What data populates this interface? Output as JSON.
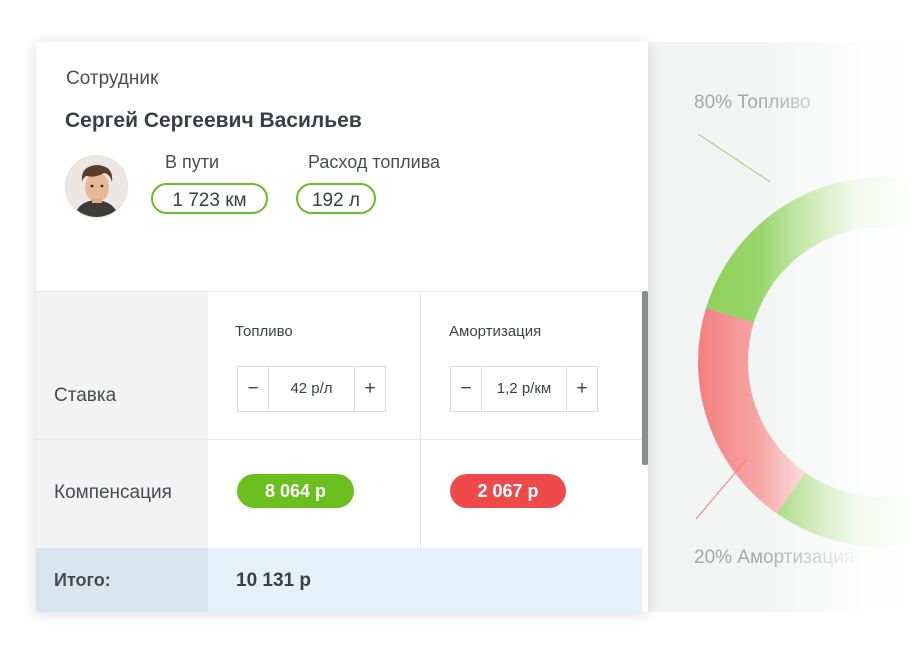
{
  "employee": {
    "section_label": "Сотрудник",
    "name": "Сергей Сергеевич Васильев",
    "distance_label": "В пути",
    "distance_value": "1 723 км",
    "fuel_label": "Расход топлива",
    "fuel_value": "192 л"
  },
  "table": {
    "rate_label": "Ставка",
    "compensation_label": "Компенсация",
    "total_label": "Итого:",
    "total_value": "10 131 р",
    "columns": [
      {
        "header": "Топливо",
        "rate_value": "42 р/л",
        "compensation": "8 064 р",
        "badge_color": "#6bbf1f"
      },
      {
        "header": "Амортизация",
        "rate_value": "1,2 р/км",
        "compensation": "2 067 р",
        "badge_color": "#ee4a4a"
      }
    ],
    "minus": "−",
    "plus": "+"
  },
  "chart": {
    "fuel_label": "80% Топливо",
    "amortization_label": "20% Амортизация",
    "fuel_color": "#8fd15c",
    "amortization_color": "#f58c8c"
  },
  "chart_data": {
    "type": "pie",
    "categories": [
      "Топливо",
      "Амортизация"
    ],
    "values": [
      80,
      20
    ],
    "colors": [
      "#8fd15c",
      "#f58c8c"
    ]
  }
}
